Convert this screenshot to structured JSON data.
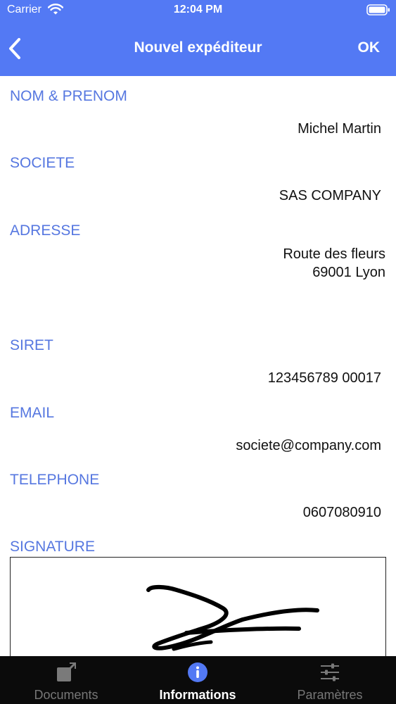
{
  "status_bar": {
    "carrier": "Carrier",
    "time": "12:04 PM"
  },
  "nav": {
    "title": "Nouvel expéditeur",
    "ok_label": "OK"
  },
  "form": {
    "name": {
      "label": "NOM & PRENOM",
      "value": "Michel Martin"
    },
    "company": {
      "label": "SOCIETE",
      "value": "SAS COMPANY"
    },
    "address": {
      "label": "ADRESSE",
      "line1": "Route des fleurs",
      "line2": "69001 Lyon"
    },
    "siret": {
      "label": "SIRET",
      "value": "123456789 00017"
    },
    "email": {
      "label": "EMAIL",
      "value": "societe@company.com"
    },
    "phone": {
      "label": "TELEPHONE",
      "value": "0607080910"
    },
    "signature": {
      "label": "SIGNATURE"
    }
  },
  "tabs": [
    {
      "label": "Documents",
      "icon": "compose-icon",
      "active": false
    },
    {
      "label": "Informations",
      "icon": "info-icon",
      "active": true
    },
    {
      "label": "Paramètres",
      "icon": "sliders-icon",
      "active": false
    }
  ],
  "colors": {
    "accent": "#5379F4",
    "label": "#5677E0",
    "tabbar": "#0b0b0b"
  }
}
